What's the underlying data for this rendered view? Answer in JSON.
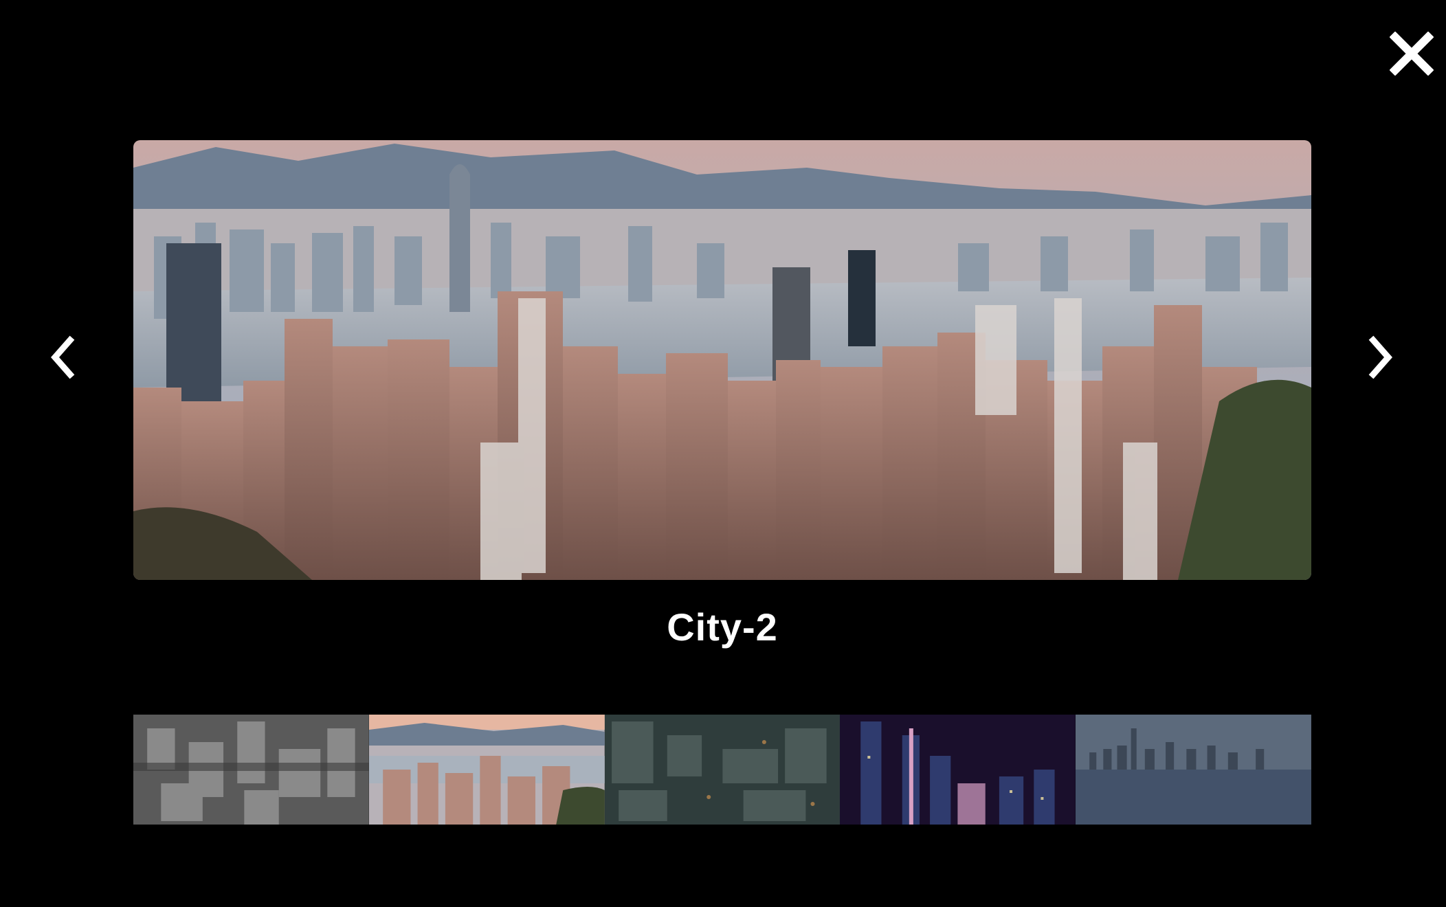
{
  "lightbox": {
    "caption": "City-2",
    "active_index": 1,
    "icons": {
      "close": "close-icon",
      "prev": "chevron-left-icon",
      "next": "chevron-right-icon"
    },
    "thumbnails": [
      {
        "name": "thumbnail-1",
        "theme": "grayscale-aerial"
      },
      {
        "name": "thumbnail-2",
        "theme": "harbour-skyline-dusk"
      },
      {
        "name": "thumbnail-3",
        "theme": "aerial-night-teal"
      },
      {
        "name": "thumbnail-4",
        "theme": "night-towers-purple"
      },
      {
        "name": "thumbnail-5",
        "theme": "blue-skyline-reflection"
      }
    ]
  }
}
